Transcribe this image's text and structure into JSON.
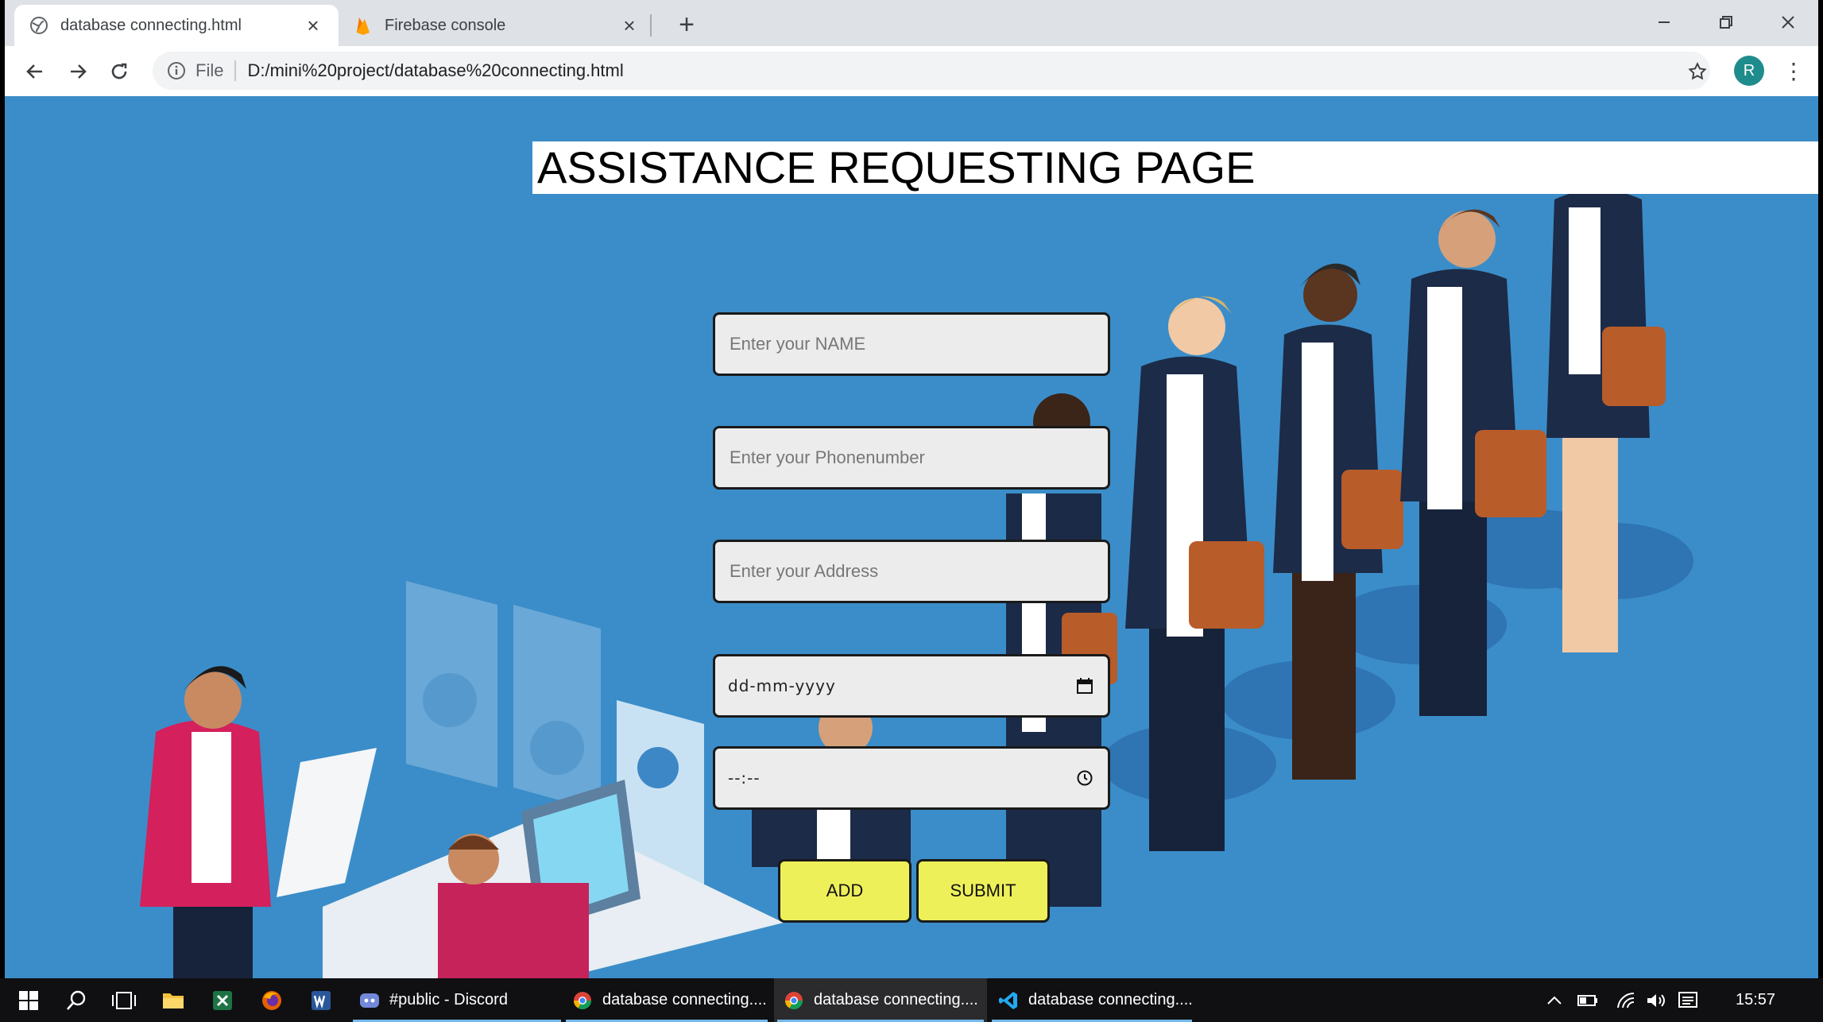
{
  "browser": {
    "tabs": [
      {
        "title": "database connecting.html",
        "icon": "globe-icon",
        "active": true
      },
      {
        "title": "Firebase console",
        "icon": "firebase-icon",
        "active": false
      }
    ],
    "new_tab": "+",
    "address": {
      "scheme_label": "File",
      "url": "D:/mini%20project/database%20connecting.html"
    },
    "profile_initial": "R"
  },
  "page": {
    "title": "ASSISTANCE REQUESTING PAGE",
    "fields": {
      "name_placeholder": "Enter your NAME",
      "phone_placeholder": "Enter your Phonenumber",
      "address_placeholder": "Enter your Address",
      "date_mask": "dd-mm-yyyy",
      "time_mask": "--:--"
    },
    "buttons": {
      "add": "ADD",
      "submit": "SUBMIT"
    },
    "accent_colors": {
      "background": "#3b8dc9",
      "button": "#eef05a"
    }
  },
  "taskbar": {
    "apps": [
      {
        "label": "#public - Discord",
        "icon": "discord-icon",
        "active": false
      },
      {
        "label": "database connecting....",
        "icon": "chrome-icon",
        "active": false
      },
      {
        "label": "database connecting....",
        "icon": "chrome-icon",
        "active": true
      },
      {
        "label": "database connecting....",
        "icon": "vscode-icon",
        "active": false
      }
    ],
    "clock": "15:57"
  }
}
